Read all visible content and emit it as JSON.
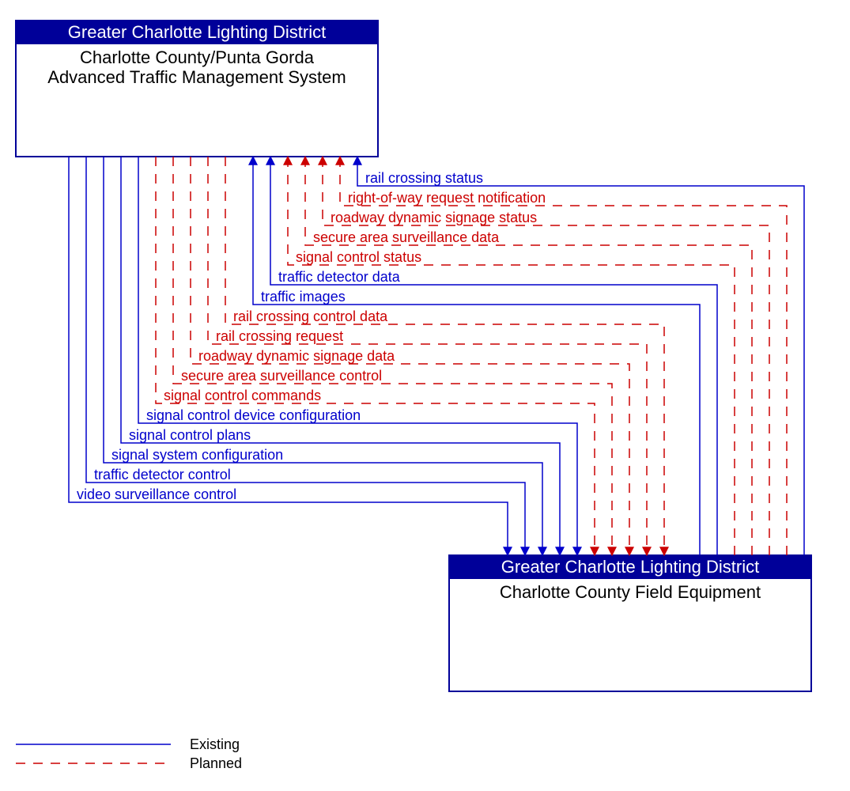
{
  "topBox": {
    "header": "Greater Charlotte Lighting District",
    "bodyLine1": "Charlotte County/Punta Gorda",
    "bodyLine2": "Advanced Traffic Management System"
  },
  "bottomBox": {
    "header": "Greater Charlotte Lighting District",
    "body": "Charlotte County Field Equipment"
  },
  "legend": {
    "existing": "Existing",
    "planned": "Planned"
  },
  "flows": {
    "up": [
      {
        "label": "rail crossing status",
        "status": "existing"
      },
      {
        "label": "right-of-way request notification",
        "status": "planned"
      },
      {
        "label": "roadway dynamic signage status",
        "status": "planned"
      },
      {
        "label": "secure area surveillance data",
        "status": "planned"
      },
      {
        "label": "signal control status",
        "status": "planned"
      },
      {
        "label": "traffic detector data",
        "status": "existing"
      },
      {
        "label": "traffic images",
        "status": "existing"
      }
    ],
    "down": [
      {
        "label": "rail crossing control data",
        "status": "planned"
      },
      {
        "label": "rail crossing request",
        "status": "planned"
      },
      {
        "label": "roadway dynamic signage data",
        "status": "planned"
      },
      {
        "label": "secure area surveillance control",
        "status": "planned"
      },
      {
        "label": "signal control commands",
        "status": "planned"
      },
      {
        "label": "signal control device configuration",
        "status": "existing"
      },
      {
        "label": "signal control plans",
        "status": "existing"
      },
      {
        "label": "signal system configuration",
        "status": "existing"
      },
      {
        "label": "traffic detector control",
        "status": "existing"
      },
      {
        "label": "video surveillance control",
        "status": "existing"
      }
    ]
  }
}
